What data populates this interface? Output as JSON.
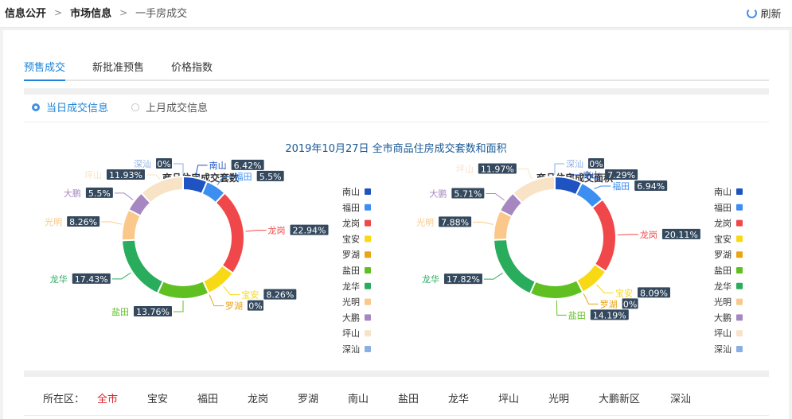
{
  "breadcrumb": {
    "items": [
      "信息公开",
      "市场信息",
      "一手房成交"
    ],
    "separator": ">"
  },
  "toolbar": {
    "refresh_label": "刷新"
  },
  "tabs": [
    {
      "label": "预售成交",
      "active": true
    },
    {
      "label": "新批准预售",
      "active": false
    },
    {
      "label": "价格指数",
      "active": false
    }
  ],
  "radios": [
    {
      "label": "当日成交信息",
      "checked": true
    },
    {
      "label": "上月成交信息",
      "checked": false
    }
  ],
  "main_title": "2019年10月27日 全市商品住房成交套数和面积",
  "chart_data": [
    {
      "type": "pie",
      "title": "商品住房成交套数",
      "categories": [
        "南山",
        "福田",
        "龙岗",
        "宝安",
        "罗湖",
        "盐田",
        "龙华",
        "光明",
        "大鹏",
        "坪山",
        "深汕"
      ],
      "values": [
        6.42,
        5.5,
        22.94,
        8.26,
        0,
        13.76,
        17.43,
        8.26,
        5.5,
        11.93,
        0
      ],
      "labels": [
        "6.42%",
        "5.5%",
        "22.94%",
        "8.26%",
        "0%",
        "13.76%",
        "17.43%",
        "8.26%",
        "5.5%",
        "11.93%",
        "0%"
      ],
      "colors": [
        "#1f53c2",
        "#3c8ef0",
        "#f0484a",
        "#f7d915",
        "#e8a514",
        "#60c022",
        "#2aac5d",
        "#f9c88a",
        "#a687c2",
        "#f8e3c6",
        "#8ab0e3"
      ],
      "legend_position": "right"
    },
    {
      "type": "pie",
      "title": "商品住房成交面积",
      "categories": [
        "南山",
        "福田",
        "龙岗",
        "宝安",
        "罗湖",
        "盐田",
        "龙华",
        "光明",
        "大鹏",
        "坪山",
        "深汕"
      ],
      "values": [
        7.29,
        6.94,
        20.11,
        8.09,
        0,
        14.19,
        17.82,
        7.88,
        5.71,
        11.97,
        0
      ],
      "labels": [
        "7.29%",
        "6.94%",
        "20.11%",
        "8.09%",
        "0%",
        "14.19%",
        "17.82%",
        "7.88%",
        "5.71%",
        "11.97%",
        "0%"
      ],
      "colors": [
        "#1f53c2",
        "#3c8ef0",
        "#f0484a",
        "#f7d915",
        "#e8a514",
        "#60c022",
        "#2aac5d",
        "#f9c88a",
        "#a687c2",
        "#f8e3c6",
        "#8ab0e3"
      ],
      "legend_position": "right"
    }
  ],
  "district_filter": {
    "label": "所在区：",
    "items": [
      "全市",
      "宝安",
      "福田",
      "龙岗",
      "罗湖",
      "南山",
      "盐田",
      "龙华",
      "坪山",
      "光明",
      "大鹏新区",
      "深汕"
    ],
    "selected": "全市"
  }
}
